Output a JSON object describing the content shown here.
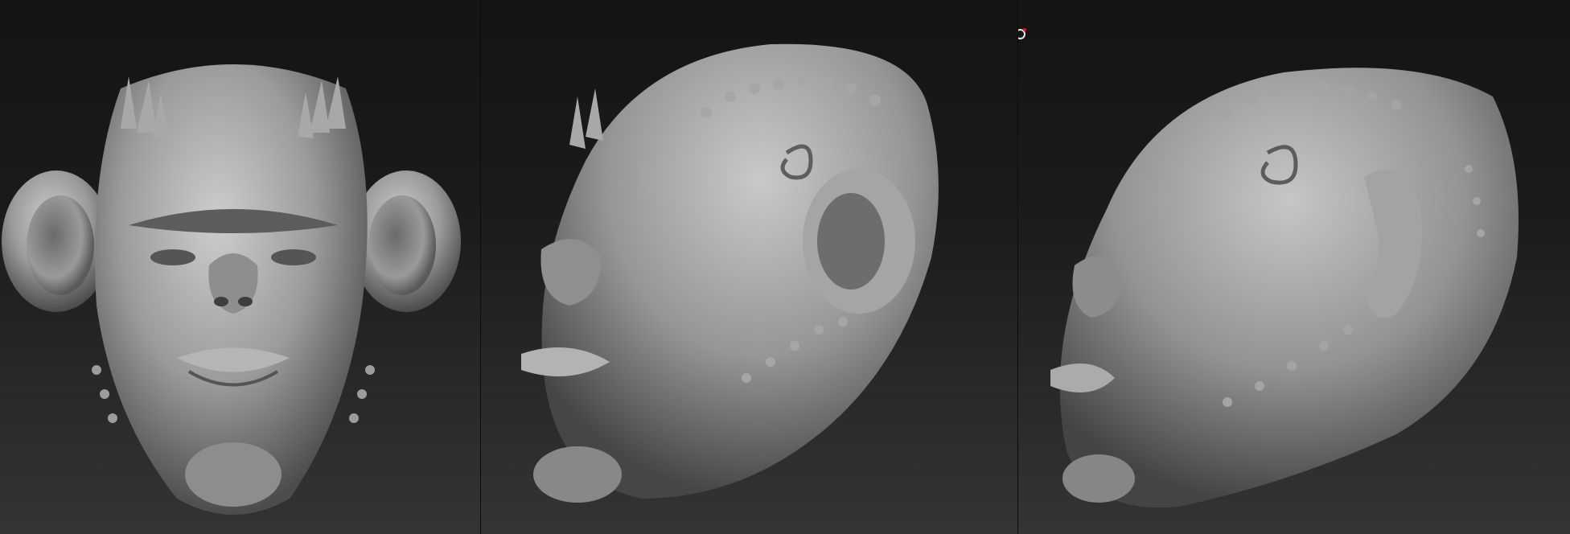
{
  "viewports": [
    {
      "view": "front",
      "pivot_icon": "rotation-pivot-icon"
    },
    {
      "view": "three-quarter",
      "pivot_icon": "rotation-pivot-icon"
    },
    {
      "view": "side",
      "pivot_icon": "rotation-pivot-icon"
    }
  ],
  "colors": {
    "background_top": "#141414",
    "background_bottom": "#343434",
    "clay": "#9a9a9a",
    "clay_shadow": "#4a4a4a",
    "clay_highlight": "#cfcfcf"
  }
}
